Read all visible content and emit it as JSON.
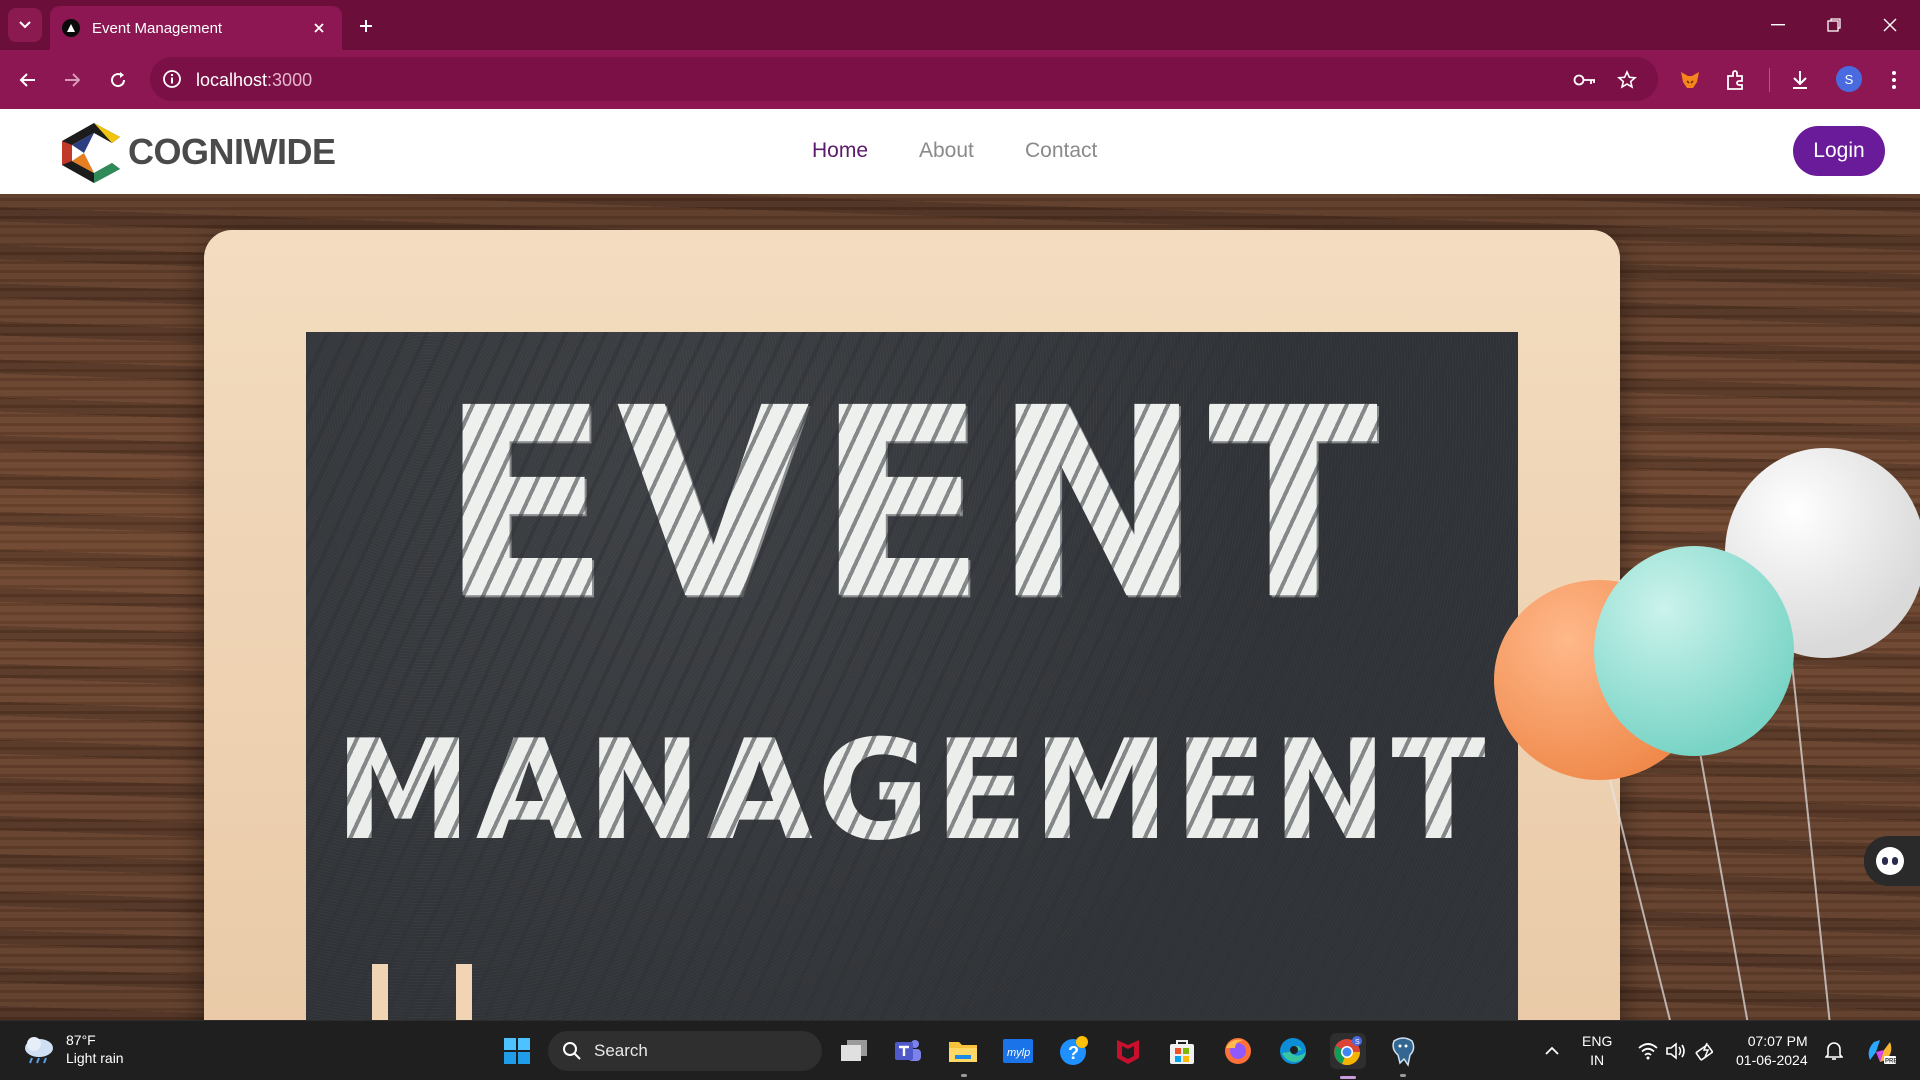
{
  "browser": {
    "tab": {
      "title": "Event Management",
      "favicon": "triangle-logo-icon"
    },
    "address": {
      "host": "localhost",
      "port": ":3000"
    },
    "profile_initial": "S",
    "icons": [
      "tab-search-icon",
      "close-icon",
      "new-tab-icon",
      "minimize-icon",
      "restore-icon",
      "window-close-icon",
      "back-icon",
      "forward-icon",
      "reload-icon",
      "info-icon",
      "password-key-icon",
      "bookmark-star-icon",
      "metamask-extension-icon",
      "extensions-puzzle-icon",
      "download-icon",
      "kebab-menu-icon"
    ]
  },
  "site": {
    "logo": {
      "text": "COGNIWIDE",
      "colors": [
        "#1c1c1c",
        "#c0392b",
        "#2e8b57",
        "#f1c40f"
      ]
    },
    "nav": [
      {
        "label": "Home",
        "active": true
      },
      {
        "label": "About",
        "active": false
      },
      {
        "label": "Contact",
        "active": false
      }
    ],
    "login_label": "Login",
    "accent": "#6a1b9a"
  },
  "hero": {
    "line1": "EVENT",
    "line2": "MANAGEMENT"
  },
  "taskbar": {
    "weather": {
      "temp": "87°F",
      "condition": "Light rain"
    },
    "search_label": "Search",
    "language": {
      "line1": "ENG",
      "line2": "IN"
    },
    "clock": {
      "time": "07:07 PM",
      "date": "01-06-2024"
    },
    "apps": [
      "windows-start-icon",
      "task-view-icon",
      "teams-icon",
      "file-explorer-icon",
      "mylp-icon",
      "help-icon",
      "mcafee-icon",
      "microsoft-store-icon",
      "firefox-icon",
      "edge-icon",
      "chrome-icon",
      "postgresql-icon"
    ]
  }
}
